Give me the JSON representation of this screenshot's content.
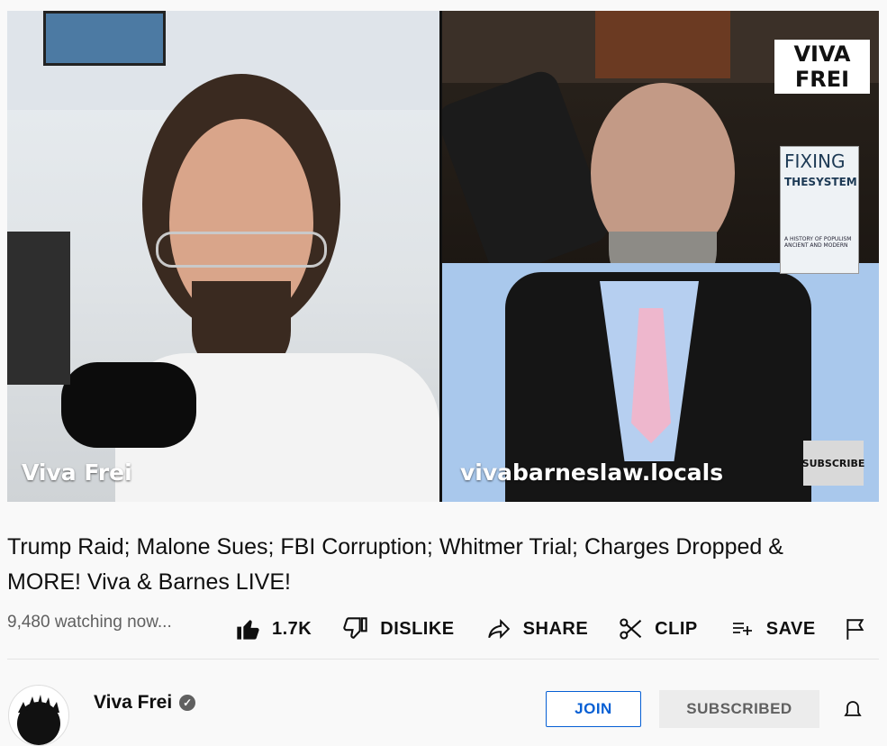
{
  "video": {
    "left_name": "Viva Frei",
    "right_name": "vivabarneslaw.locals",
    "logo_line1": "VIVA",
    "logo_line2": "FREI",
    "subscribe_overlay": "SUBSCRIBE",
    "book_title_1": "FIXING",
    "book_title_2": "THESYSTEM",
    "book_subtitle": "A HISTORY OF POPULISM ANCIENT AND MODERN"
  },
  "title_line1": "Trump Raid; Malone Sues; FBI Corruption; Whitmer Trial; Charges Dropped &",
  "title_line2": "MORE! Viva & Barnes LIVE!",
  "watching": "9,480 watching now...",
  "actions": {
    "like": "1.7K",
    "dislike": "DISLIKE",
    "share": "SHARE",
    "clip": "CLIP",
    "save": "SAVE"
  },
  "channel": {
    "name": "Viva Frei",
    "join": "JOIN",
    "subscribed": "SUBSCRIBED"
  },
  "icons": [
    "like-icon",
    "dislike-icon",
    "share-icon",
    "clip-icon",
    "save-icon",
    "flag-icon",
    "verified-icon",
    "bell-icon"
  ]
}
